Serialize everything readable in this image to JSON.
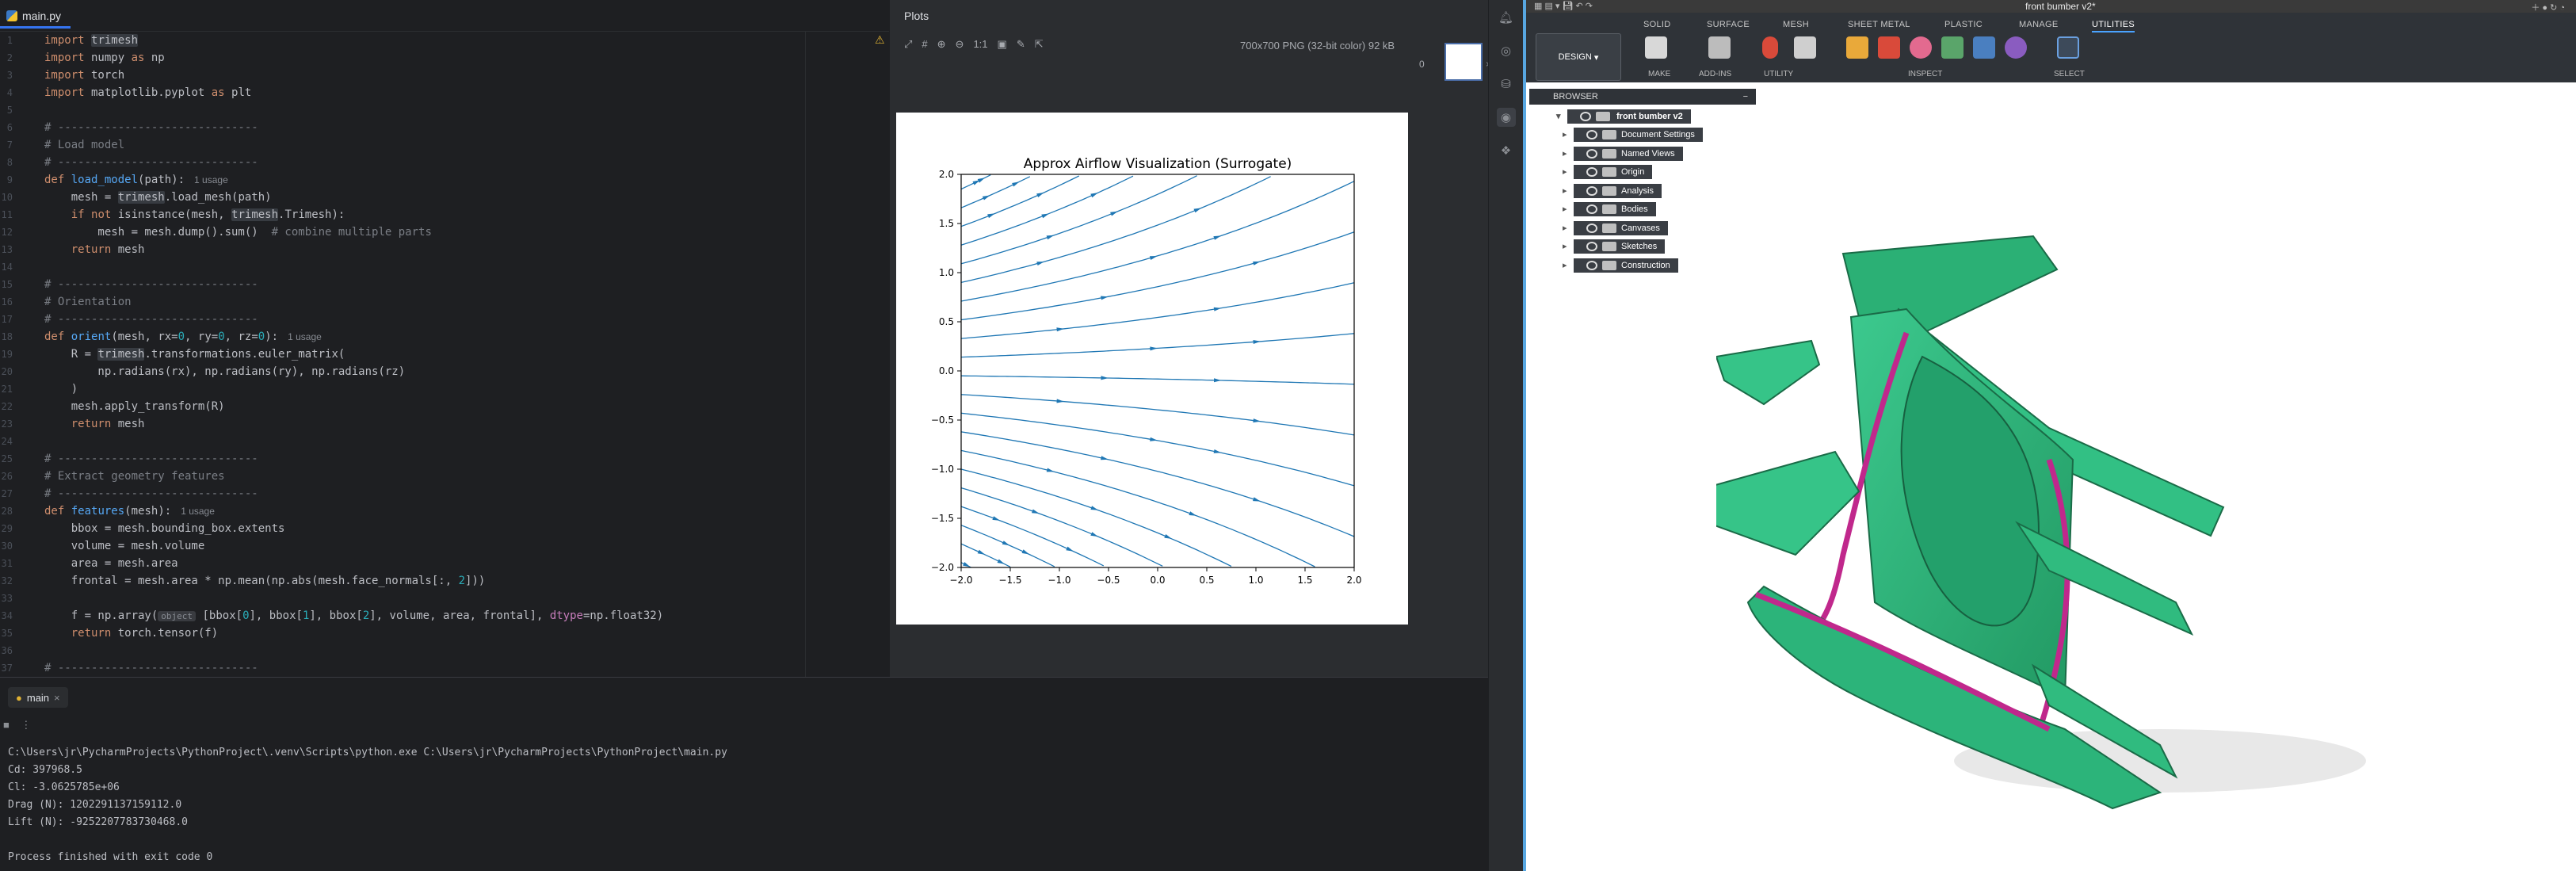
{
  "ide": {
    "file_tab": "main.py",
    "run_tab": "main",
    "code_lines": [
      "import trimesh",
      "import numpy as np",
      "import torch",
      "import matplotlib.pyplot as plt",
      "",
      "# ------------------------------",
      "# Load model",
      "# ------------------------------",
      "def load_model(path):",
      "    mesh = trimesh.load_mesh(path)",
      "    if not isinstance(mesh, trimesh.Trimesh):",
      "        mesh = mesh.dump().sum()  # combine multiple parts",
      "    return mesh",
      "",
      "# ------------------------------",
      "# Orientation",
      "# ------------------------------",
      "def orient(mesh, rx=0, ry=0, rz=0):",
      "    R = trimesh.transformations.euler_matrix(",
      "        np.radians(rx), np.radians(ry), np.radians(rz)",
      "    )",
      "    mesh.apply_transform(R)",
      "    return mesh",
      "",
      "# ------------------------------",
      "# Extract geometry features",
      "# ------------------------------",
      "def features(mesh):",
      "    bbox = mesh.bounding_box.extents",
      "    volume = mesh.volume",
      "    area = mesh.area",
      "    frontal = mesh.area * np.mean(np.abs(mesh.face_normals[:, 2]))",
      "",
      "    f = np.array( [bbox[0], bbox[1], bbox[2], volume, area, frontal], dtype=np.float32)",
      "    return torch.tensor(f)",
      "",
      "# ------------------------------"
    ],
    "usage_hint": "1 usage",
    "inlay_object": "object",
    "console": [
      "C:\\Users\\jr\\PycharmProjects\\PythonProject\\.venv\\Scripts\\python.exe C:\\Users\\jr\\PycharmProjects\\PythonProject\\main.py",
      "Cd: 397968.5",
      "Cl: -3.0625785e+06",
      "Drag (N): 1202291137159112.0",
      "Lift (N): -9252207783730468.0",
      "",
      "Process finished with exit code 0"
    ]
  },
  "plots": {
    "title": "Plots",
    "info": "700x700 PNG (32-bit color) 92 kB",
    "zoom_label": "1:1",
    "thumb_index": "0"
  },
  "chart_data": {
    "type": "streamplot",
    "title": "Approx Airflow Visualization (Surrogate)",
    "xlabel": "",
    "ylabel": "",
    "xlim": [
      -2.0,
      2.0
    ],
    "ylim": [
      -2.0,
      2.0
    ],
    "xticks": [
      "−2.0",
      "−1.5",
      "−1.0",
      "−0.5",
      "0.0",
      "0.5",
      "1.0",
      "1.5",
      "2.0"
    ],
    "yticks": [
      "2.0",
      "1.5",
      "1.0",
      "0.5",
      "0.0",
      "−0.5",
      "−1.0",
      "−1.5",
      "−2.0"
    ],
    "line_color": "#1f77b4",
    "flow": "left-to-right, diverging away from y=0 (upward above, downward below)"
  },
  "fusion": {
    "title": "front bumber v2*",
    "design_label": "DESIGN",
    "tabs": [
      "SOLID",
      "SURFACE",
      "MESH",
      "SHEET METAL",
      "PLASTIC",
      "MANAGE",
      "UTILITIES"
    ],
    "active_tab": "UTILITIES",
    "groups": [
      "MAKE",
      "ADD-INS",
      "UTILITY",
      "INSPECT",
      "SELECT"
    ],
    "browser_label": "BROWSER",
    "tree_root": "front bumber v2",
    "tree_items": [
      "Document Settings",
      "Named Views",
      "Origin",
      "Analysis",
      "Bodies",
      "Canvases",
      "Sketches",
      "Construction"
    ],
    "model_color": "#2fb37c",
    "edge_color": "#c0288c"
  }
}
